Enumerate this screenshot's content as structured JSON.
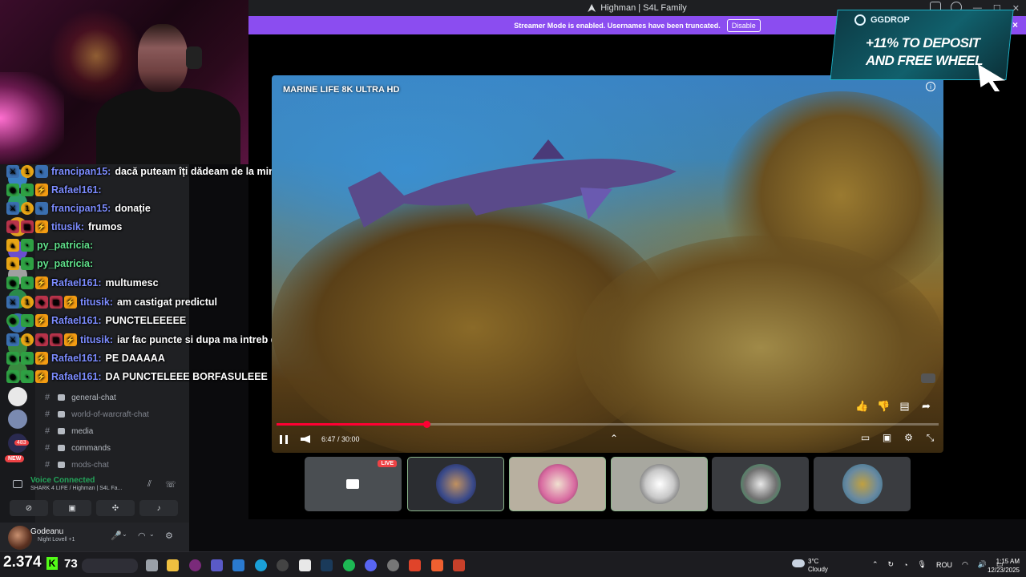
{
  "window": {
    "title": "Highman | S4L Family"
  },
  "banner": {
    "text": "Streamer Mode is enabled. Usernames have been truncated.",
    "disable_label": "Disable",
    "close": "×"
  },
  "video": {
    "title": "MARINE LIFE 8K ULTRA HD",
    "time": "6:47 / 30:00",
    "progress": 0.226
  },
  "chat": [
    {
      "user": "francipan15:",
      "text": "dacă puteam îți dădeam de la mine"
    },
    {
      "user": "Rafael161:",
      "text": ""
    },
    {
      "user": "francipan15:",
      "text": "donație"
    },
    {
      "user": "titusik:",
      "text": "frumos"
    },
    {
      "user": "py_patricia:",
      "text": ""
    },
    {
      "user": "py_patricia:",
      "text": ""
    },
    {
      "user": "Rafael161:",
      "text": "multumesc"
    },
    {
      "user": "titusik:",
      "text": "am castigat predictul"
    },
    {
      "user": "Rafael161:",
      "text": "PUNCTELEEEEE"
    },
    {
      "user": "titusik:",
      "text": "iar fac puncte si dupa ma intreb de"
    },
    {
      "user": "Rafael161:",
      "text": "PE DAAAAA"
    },
    {
      "user": "Rafael161:",
      "text": "DA PUNCTELEEE BORFASULEEE"
    }
  ],
  "channels": [
    {
      "name": "general-chat",
      "muted": false
    },
    {
      "name": "world-of-warcraft-chat",
      "muted": true
    },
    {
      "name": "media",
      "muted": false
    },
    {
      "name": "commands",
      "muted": false
    },
    {
      "name": "mods-chat",
      "muted": true
    }
  ],
  "guild_badges": {
    "mentions": "483",
    "new": "NEW"
  },
  "voice": {
    "status": "Voice Connected",
    "channel": "SHARK 4 LIFE / Highman | S4L Fa..."
  },
  "user": {
    "name": "Godeanu",
    "status": "Night Lovell +1"
  },
  "tiles": {
    "live_label": "LIVE"
  },
  "ad": {
    "brand": "GGDROP",
    "line1": "+11% TO DEPOSIT",
    "line2": "AND FREE WHEEL"
  },
  "overlay": {
    "points": "2.374",
    "kick_count": "73",
    "kick_letter": "K"
  },
  "taskbar": {
    "weather_temp": "3°C",
    "weather_cond": "Cloudy",
    "lang": "ROU",
    "time": "1:15 AM",
    "date": "12/23/2025"
  },
  "colors": {
    "streamer_banner": "#8b4df0",
    "voice_green": "#23a55a",
    "progress_red": "#ff0033",
    "live_red": "#ed4245"
  }
}
